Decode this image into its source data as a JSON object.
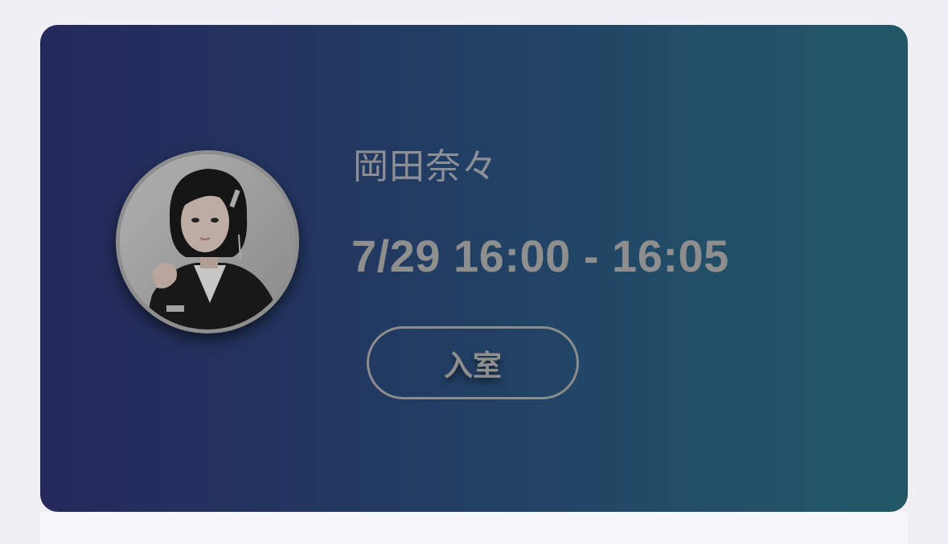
{
  "event": {
    "member_name": "岡田奈々",
    "time_slot": "7/29 16:00 - 16:05",
    "enter_button_label": "入室"
  },
  "avatar": {
    "icon": "member-photo"
  },
  "colors": {
    "page_background": "#efeff5",
    "card_gradient_start": "#25295a",
    "card_gradient_end": "#225866",
    "text_muted": "#8e8e8e"
  }
}
